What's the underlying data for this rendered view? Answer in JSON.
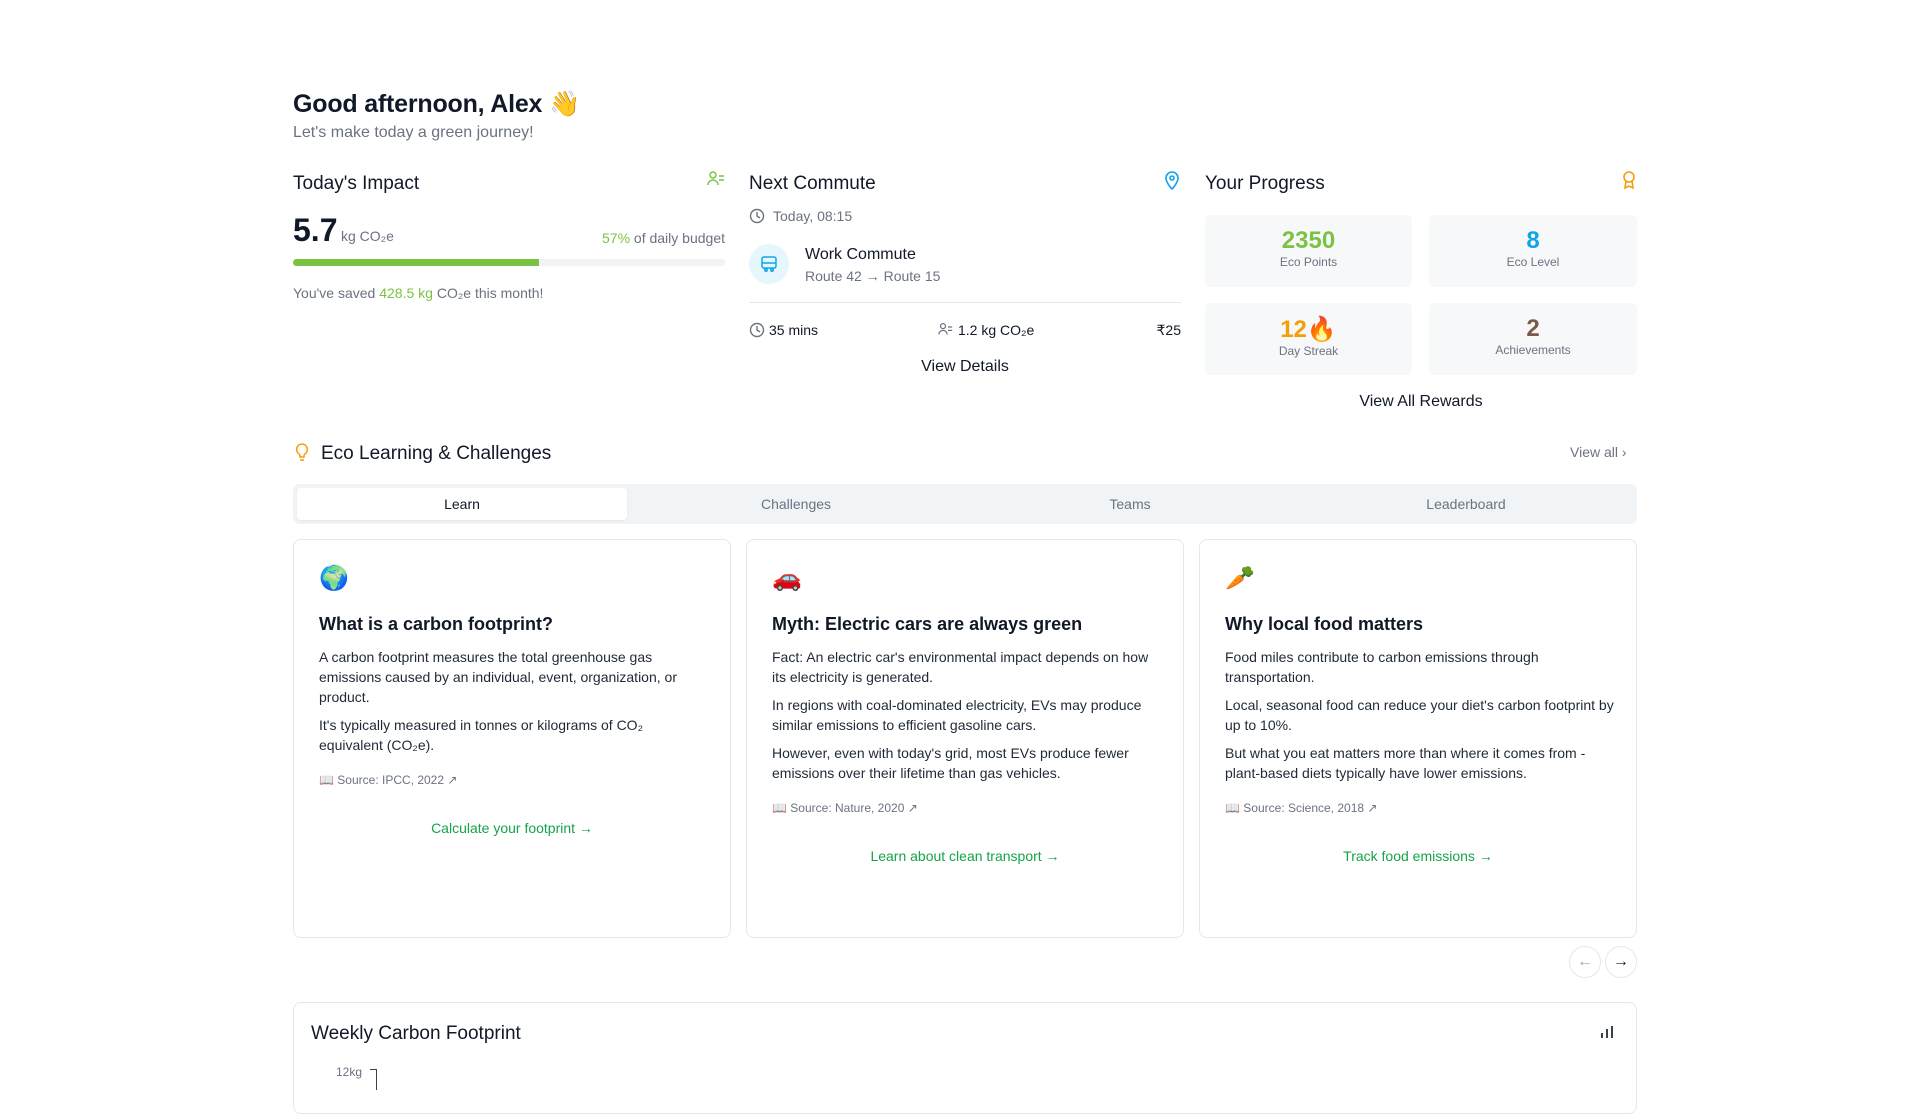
{
  "header": {
    "greeting": "Good afternoon, Alex 👋",
    "subtitle": "Let's make today a green journey!"
  },
  "impact": {
    "title": "Today's Impact",
    "icon": "leaf-user-icon",
    "value": "5.7",
    "unit": "kg CO₂e",
    "budget_percent_text": "57%",
    "budget_suffix": " of daily budget",
    "budget_fraction": 0.57,
    "saved_prefix": "You've saved ",
    "saved_amount": "428.5 kg",
    "saved_suffix": " CO₂e this month!"
  },
  "commute": {
    "title": "Next Commute",
    "icon": "map-pin-icon",
    "time": "Today, 08:15",
    "name": "Work Commute",
    "route": "Route 42 → Route 15",
    "duration": "35 mins",
    "emissions": "1.2 kg CO₂e",
    "cost": "₹25",
    "details_label": "View Details"
  },
  "progress": {
    "title": "Your Progress",
    "icon": "award-icon",
    "stats": [
      {
        "value": "2350",
        "label": "Eco Points",
        "color": "#7cc242"
      },
      {
        "value": "8",
        "label": "Eco Level",
        "color": "#0ea5e9"
      },
      {
        "value": "12🔥",
        "label": "Day Streak",
        "color": "#f59e0b"
      },
      {
        "value": "2",
        "label": "Achievements",
        "color": "#7c5a48"
      }
    ],
    "rewards_label": "View All Rewards"
  },
  "learning": {
    "title": "Eco Learning & Challenges",
    "icon": "lightbulb-icon",
    "view_all": "View all",
    "tabs": [
      "Learn",
      "Challenges",
      "Teams",
      "Leaderboard"
    ],
    "active_tab": "Learn",
    "cards": [
      {
        "emoji": "🌍",
        "title": "What is a carbon footprint?",
        "paragraphs": [
          "A carbon footprint measures the total greenhouse gas emissions caused by an individual, event, organization, or product.",
          "It's typically measured in tonnes or kilograms of CO₂ equivalent (CO₂e)."
        ],
        "source": "Source: IPCC, 2022",
        "link": "Calculate your footprint →"
      },
      {
        "emoji": "🚗",
        "title": "Myth: Electric cars are always green",
        "paragraphs": [
          "Fact: An electric car's environmental impact depends on how its electricity is generated.",
          "In regions with coal-dominated electricity, EVs may produce similar emissions to efficient gasoline cars.",
          "However, even with today's grid, most EVs produce fewer emissions over their lifetime than gas vehicles."
        ],
        "source": "Source: Nature, 2020",
        "link": "Learn about clean transport →"
      },
      {
        "emoji": "🥕",
        "title": "Why local food matters",
        "paragraphs": [
          "Food miles contribute to carbon emissions through transportation.",
          "Local, seasonal food can reduce your diet's carbon footprint by up to 10%.",
          "But what you eat matters more than where it comes from - plant-based diets typically have lower emissions."
        ],
        "source": "Source: Science, 2018",
        "link": "Track food emissions →"
      }
    ]
  },
  "weekly": {
    "title": "Weekly Carbon Footprint",
    "icon": "bar-chart-icon",
    "y_top_label": "12kg"
  }
}
